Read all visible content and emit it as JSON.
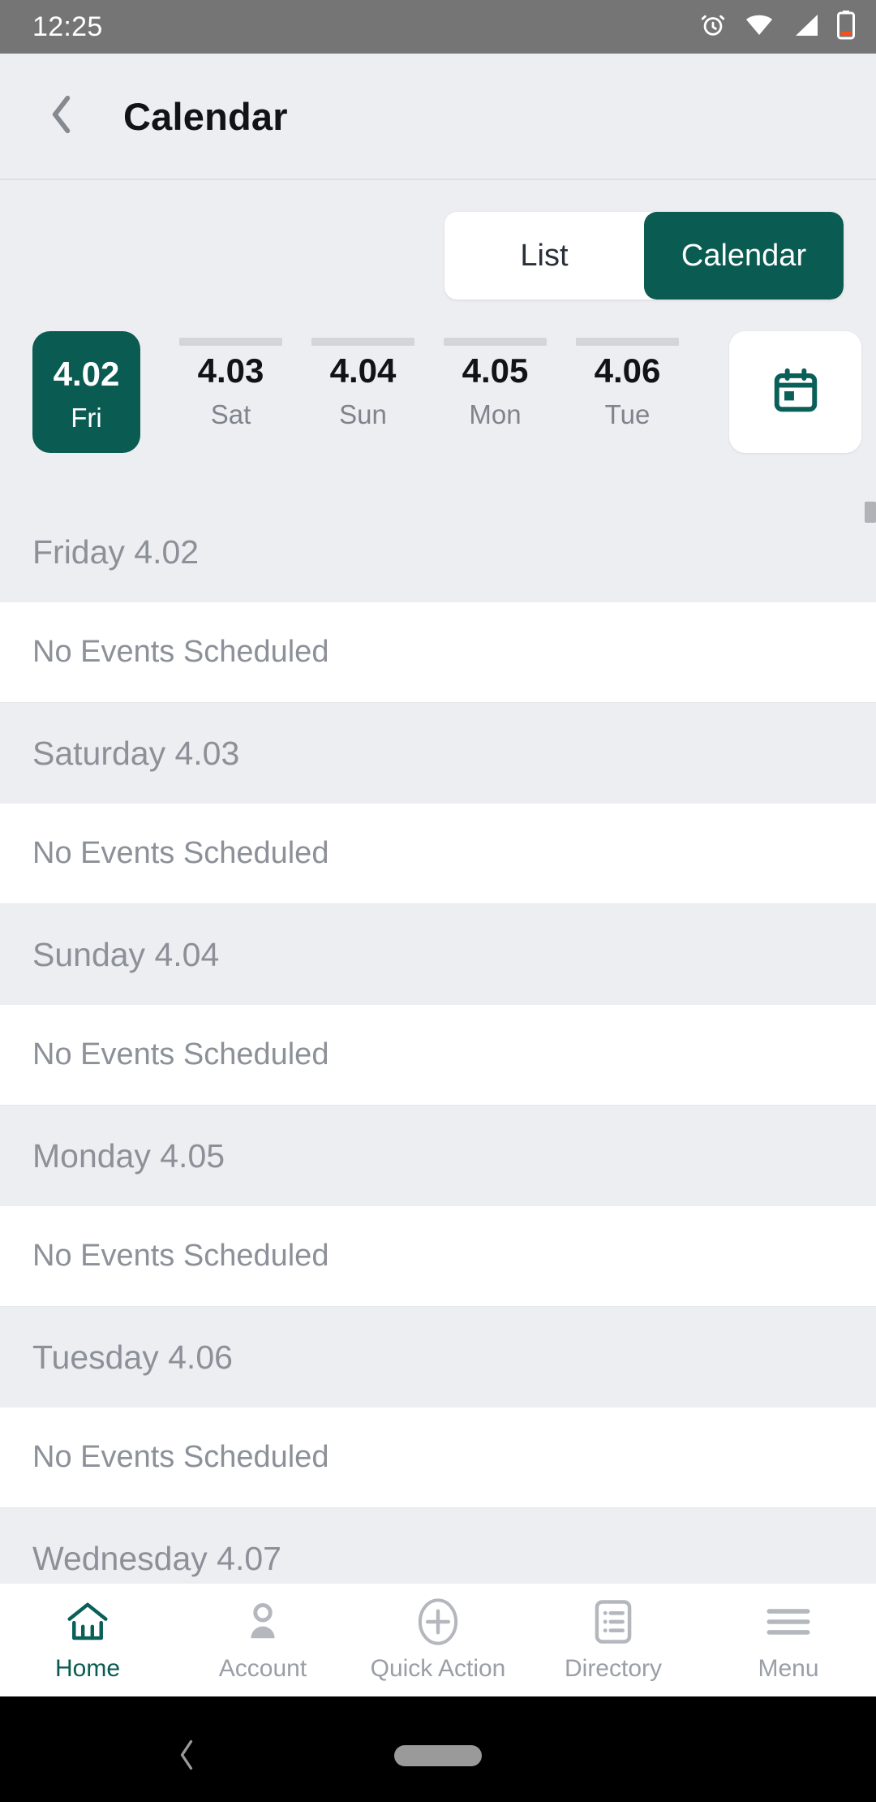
{
  "status_bar": {
    "time": "12:25",
    "icons": [
      "alarm-icon",
      "wifi-icon",
      "cell-signal-icon",
      "battery-icon"
    ]
  },
  "app_bar": {
    "back_icon": "chevron-left-icon",
    "title": "Calendar"
  },
  "view_toggle": {
    "options": [
      {
        "label": "List",
        "active": false
      },
      {
        "label": "Calendar",
        "active": true
      }
    ],
    "active_color": "#0a5b52"
  },
  "date_strip": {
    "dates": [
      {
        "date": "4.02",
        "dow": "Fri",
        "selected": true
      },
      {
        "date": "4.03",
        "dow": "Sat",
        "selected": false
      },
      {
        "date": "4.04",
        "dow": "Sun",
        "selected": false
      },
      {
        "date": "4.05",
        "dow": "Mon",
        "selected": false
      },
      {
        "date": "4.06",
        "dow": "Tue",
        "selected": false
      }
    ],
    "picker_button": {
      "icon": "calendar-today-icon"
    }
  },
  "agenda": {
    "sections": [
      {
        "header": "Friday 4.02",
        "event": "No Events Scheduled"
      },
      {
        "header": "Saturday 4.03",
        "event": "No Events Scheduled"
      },
      {
        "header": "Sunday 4.04",
        "event": "No Events Scheduled"
      },
      {
        "header": "Monday 4.05",
        "event": "No Events Scheduled"
      },
      {
        "header": "Tuesday 4.06",
        "event": "No Events Scheduled"
      },
      {
        "header": "Wednesday 4.07",
        "event": ""
      }
    ]
  },
  "bottom_nav": {
    "items": [
      {
        "label": "Home",
        "icon": "home-icon",
        "active": true
      },
      {
        "label": "Account",
        "icon": "person-icon",
        "active": false
      },
      {
        "label": "Quick Action",
        "icon": "plus-circle-icon",
        "active": false
      },
      {
        "label": "Directory",
        "icon": "list-card-icon",
        "active": false
      },
      {
        "label": "Menu",
        "icon": "hamburger-icon",
        "active": false
      }
    ],
    "active_color": "#0a5b52",
    "inactive_color": "#9a9ea6"
  },
  "system_nav": {
    "back_icon": "system-back-icon",
    "home_pill": "system-home-pill"
  }
}
